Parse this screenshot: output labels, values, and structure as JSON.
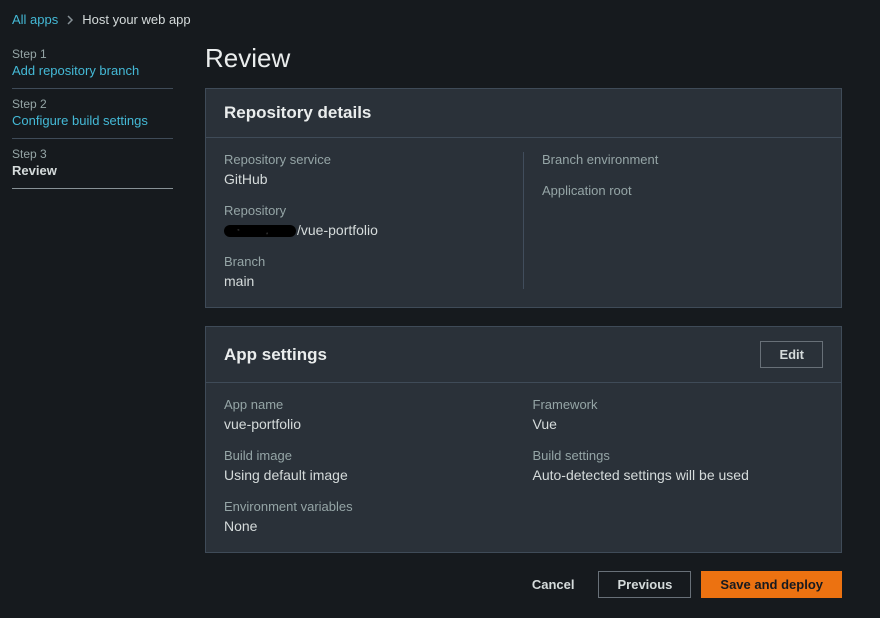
{
  "breadcrumb": {
    "all_apps": "All apps",
    "current": "Host your web app"
  },
  "sidebar": {
    "steps": [
      {
        "num": "Step 1",
        "label": "Add repository branch"
      },
      {
        "num": "Step 2",
        "label": "Configure build settings"
      },
      {
        "num": "Step 3",
        "label": "Review"
      }
    ]
  },
  "page": {
    "title": "Review"
  },
  "repo_panel": {
    "title": "Repository details",
    "fields": {
      "service_label": "Repository service",
      "service_value": "GitHub",
      "repo_label": "Repository",
      "repo_suffix": "/vue-portfolio",
      "branch_label": "Branch",
      "branch_value": "main",
      "env_label": "Branch environment",
      "root_label": "Application root"
    }
  },
  "app_panel": {
    "title": "App settings",
    "edit_label": "Edit",
    "fields": {
      "name_label": "App name",
      "name_value": "vue-portfolio",
      "image_label": "Build image",
      "image_value": "Using default image",
      "envvars_label": "Environment variables",
      "envvars_value": "None",
      "framework_label": "Framework",
      "framework_value": "Vue",
      "settings_label": "Build settings",
      "settings_value": "Auto-detected settings will be used"
    }
  },
  "actions": {
    "cancel": "Cancel",
    "previous": "Previous",
    "save": "Save and deploy"
  }
}
